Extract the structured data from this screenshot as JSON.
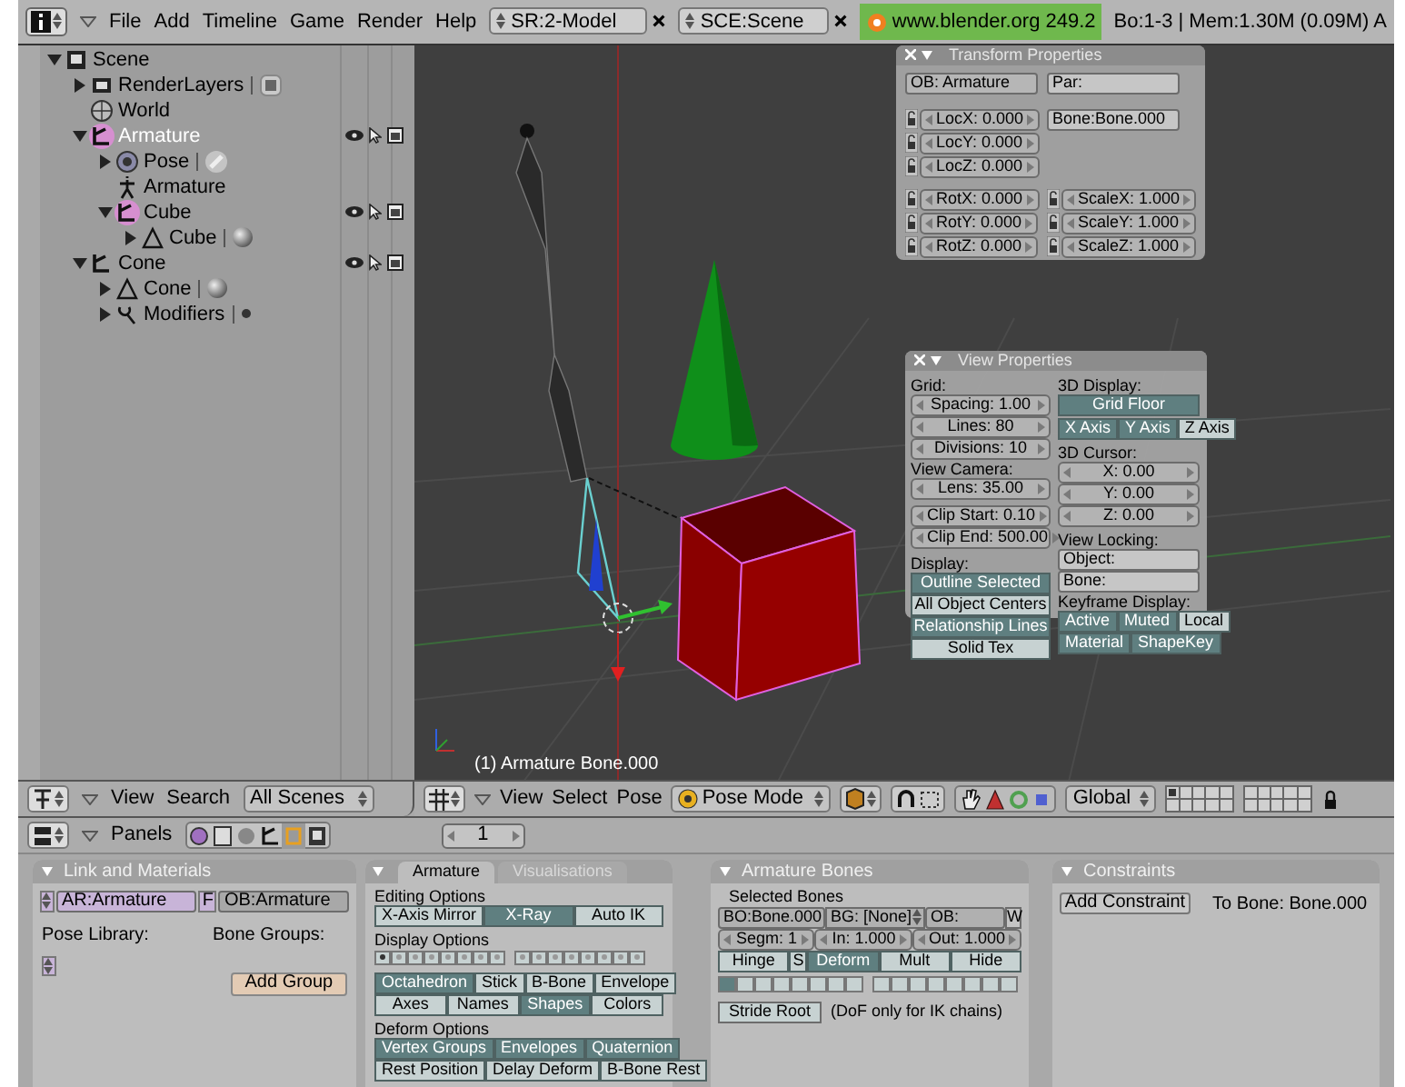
{
  "topbar": {
    "menus": [
      "File",
      "Add",
      "Timeline",
      "Game",
      "Render",
      "Help"
    ],
    "screen": "SR:2-Model",
    "scene": "SCE:Scene",
    "version": "www.blender.org 249.2",
    "stats": "Bo:1-3 | Mem:1.30M (0.09M) A"
  },
  "outliner": {
    "tree": [
      {
        "label": "Scene",
        "expanded": true,
        "selected": false,
        "active": false,
        "children": [
          {
            "label": "RenderLayers",
            "expanded": false,
            "selected": false,
            "active": false
          },
          {
            "label": "World",
            "selected": false,
            "active": false
          },
          {
            "label": "Armature",
            "expanded": true,
            "selected": true,
            "active": true,
            "children": [
              {
                "label": "Pose",
                "expanded": false,
                "selected": false,
                "active": false
              },
              {
                "label": "Armature",
                "selected": false,
                "active": false
              },
              {
                "label": "Cube",
                "expanded": true,
                "selected": true,
                "active": false,
                "children": [
                  {
                    "label": "Cube",
                    "expanded": false,
                    "selected": false,
                    "active": false
                  }
                ]
              }
            ]
          },
          {
            "label": "Cone",
            "expanded": true,
            "selected": false,
            "active": false,
            "children": [
              {
                "label": "Cone",
                "expanded": false,
                "selected": false,
                "active": false
              },
              {
                "label": "Modifiers",
                "expanded": false,
                "selected": false,
                "active": false
              }
            ]
          }
        ]
      }
    ],
    "header": {
      "menus": [
        "View",
        "Search"
      ],
      "filter": "All Scenes"
    }
  },
  "viewport": {
    "caption": "(1) Armature Bone.000",
    "transform": {
      "title": "Transform Properties",
      "object": "OB: Armature",
      "parent": "Par:",
      "bone": "Bone:Bone.000",
      "location": [
        "LocX: 0.000",
        "LocY: 0.000",
        "LocZ: 0.000"
      ],
      "rotation": [
        "RotX: 0.000",
        "RotY: 0.000",
        "RotZ: 0.000"
      ],
      "scale": [
        "ScaleX: 1.000",
        "ScaleY: 1.000",
        "ScaleZ: 1.000"
      ]
    },
    "view": {
      "title": "View Properties",
      "grid_label": "Grid:",
      "grid": [
        "Spacing: 1.00",
        "Lines: 80",
        "Divisions: 10"
      ],
      "camera_label": "View Camera:",
      "lens": "Lens: 35.00",
      "clip": [
        "Clip Start: 0.10",
        "Clip End: 500.00"
      ],
      "display_label": "Display:",
      "display": [
        {
          "label": "Outline Selected",
          "on": true
        },
        {
          "label": "All Object Centers",
          "on": false
        },
        {
          "label": "Relationship Lines",
          "on": true
        },
        {
          "label": "Solid Tex",
          "on": false
        }
      ],
      "display3d_label": "3D Display:",
      "grid_floor": {
        "label": "Grid Floor",
        "on": true
      },
      "axes": [
        {
          "label": "X Axis",
          "on": true
        },
        {
          "label": "Y Axis",
          "on": true
        },
        {
          "label": "Z Axis",
          "on": false
        }
      ],
      "cursor_label": "3D Cursor:",
      "cursor": [
        "X: 0.00",
        "Y: 0.00",
        "Z: 0.00"
      ],
      "locking_label": "View Locking:",
      "locking": [
        "Object:",
        "Bone:"
      ],
      "keyframe_label": "Keyframe Display:",
      "keyframe": [
        {
          "label": "Active",
          "on": true
        },
        {
          "label": "Muted",
          "on": true
        },
        {
          "label": "Local",
          "on": false
        },
        {
          "label": "Material",
          "on": true
        },
        {
          "label": "ShapeKey",
          "on": true
        }
      ]
    },
    "header": {
      "menus": [
        "View",
        "Select",
        "Pose"
      ],
      "mode": "Pose Mode",
      "orientation": "Global"
    }
  },
  "buttons_header": {
    "label": "Panels",
    "frame": "1"
  },
  "panels": [
    {
      "kind": "link",
      "title": "Link and Materials",
      "armature": "AR:Armature",
      "fake": "F",
      "object": "OB:Armature",
      "pose_library": "Pose Library:",
      "bone_groups": "Bone Groups:",
      "add_group": "Add Group"
    },
    {
      "kind": "armature",
      "tabs": [
        {
          "label": "Armature",
          "selected": true
        },
        {
          "label": "Visualisations",
          "selected": false
        }
      ],
      "editing_label": "Editing Options",
      "editing": [
        {
          "label": "X-Axis Mirror",
          "on": false
        },
        {
          "label": "X-Ray",
          "on": true
        },
        {
          "label": "Auto IK",
          "on": false
        }
      ],
      "display_label": "Display Options",
      "layers": [
        {
          "on": true
        },
        {
          "on": false
        },
        {
          "on": false
        },
        {
          "on": false
        },
        {
          "on": false
        },
        {
          "on": false
        },
        {
          "on": false
        },
        {
          "on": false
        },
        {
          "on": false
        },
        {
          "on": false
        },
        {
          "on": false
        },
        {
          "on": false
        },
        {
          "on": false
        },
        {
          "on": false
        },
        {
          "on": false
        },
        {
          "on": false
        }
      ],
      "draw_rows": [
        [
          {
            "label": "Octahedron",
            "on": true
          },
          {
            "label": "Stick",
            "on": false
          },
          {
            "label": "B-Bone",
            "on": false
          },
          {
            "label": "Envelope",
            "on": false
          }
        ],
        [
          {
            "label": "Axes",
            "on": false
          },
          {
            "label": "Names",
            "on": false
          },
          {
            "label": "Shapes",
            "on": true
          },
          {
            "label": "Colors",
            "on": false
          }
        ]
      ],
      "deform_label": "Deform Options",
      "deform_rows": [
        [
          {
            "label": "Vertex Groups",
            "on": true
          },
          {
            "label": "Envelopes",
            "on": true
          },
          {
            "label": "Quaternion",
            "on": true
          }
        ],
        [
          {
            "label": "Rest Position",
            "on": false
          },
          {
            "label": "Delay Deform",
            "on": false
          },
          {
            "label": "B-Bone Rest",
            "on": false
          }
        ]
      ]
    },
    {
      "kind": "bones",
      "title": "Armature Bones",
      "selected_label": "Selected Bones",
      "bone": "BO:Bone.000",
      "group": "BG: [None]",
      "object": "OB:",
      "weight": "W",
      "numbers": [
        "Segm: 1",
        "In: 1.000",
        "Out: 1.000"
      ],
      "flags": [
        {
          "label": "Hinge",
          "on": false
        },
        {
          "label": "S",
          "on": false
        },
        {
          "label": "Deform",
          "on": true
        },
        {
          "label": "Mult",
          "on": false
        },
        {
          "label": "Hide",
          "on": false
        }
      ],
      "layers": [
        {
          "on": true
        },
        {
          "on": false
        },
        {
          "on": false
        },
        {
          "on": false
        },
        {
          "on": false
        },
        {
          "on": false
        },
        {
          "on": false
        },
        {
          "on": false
        },
        {
          "on": false
        },
        {
          "on": false
        },
        {
          "on": false
        },
        {
          "on": false
        },
        {
          "on": false
        },
        {
          "on": false
        },
        {
          "on": false
        },
        {
          "on": false
        }
      ],
      "stride": "Stride Root",
      "note": "(DoF only for IK chains)"
    },
    {
      "kind": "constraints",
      "title": "Constraints",
      "add": "Add Constraint",
      "target": "To Bone: Bone.000"
    }
  ]
}
